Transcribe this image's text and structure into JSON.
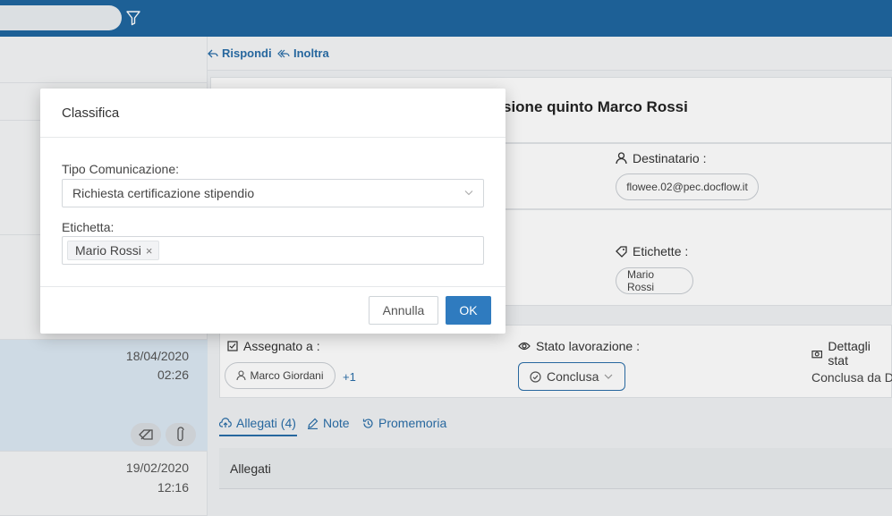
{
  "actions": {
    "reply": "Rispondi",
    "forward": "Inoltra"
  },
  "message": {
    "subject_fragment": "sione quinto Marco Rossi",
    "recipient_label": "Destinatario :",
    "recipient": "flowee.02@pec.docflow.it",
    "labels_label": "Etichette :",
    "label_chip": "Mario Rossi",
    "assigned_label": "Assegnato a :",
    "assignee": "Marco Giordani",
    "assignee_more": "+1",
    "status_label": "Stato lavorazione :",
    "status_value": "Conclusa",
    "details_label": "Dettagli stat",
    "details_value": "Conclusa da Da"
  },
  "tabs": [
    {
      "label": "Allegati (4)"
    },
    {
      "label": "Note"
    },
    {
      "label": "Promemoria"
    }
  ],
  "attachments_panel": {
    "title": "Allegati"
  },
  "list_items": [
    {
      "date": "18/04/2020",
      "time": "02:26"
    },
    {
      "date": "19/02/2020",
      "time": "12:16"
    }
  ],
  "modal": {
    "title": "Classifica",
    "type_label": "Tipo Comunicazione:",
    "type_value": "Richiesta certificazione stipendio",
    "tag_label": "Etichetta:",
    "tag_value": "Mario Rossi",
    "tag_remove": "×",
    "cancel": "Annulla",
    "ok": "OK"
  },
  "colors": {
    "accent": "#1f66a0",
    "primary_button": "#2f7bbf",
    "link": "#2a6ea8"
  }
}
